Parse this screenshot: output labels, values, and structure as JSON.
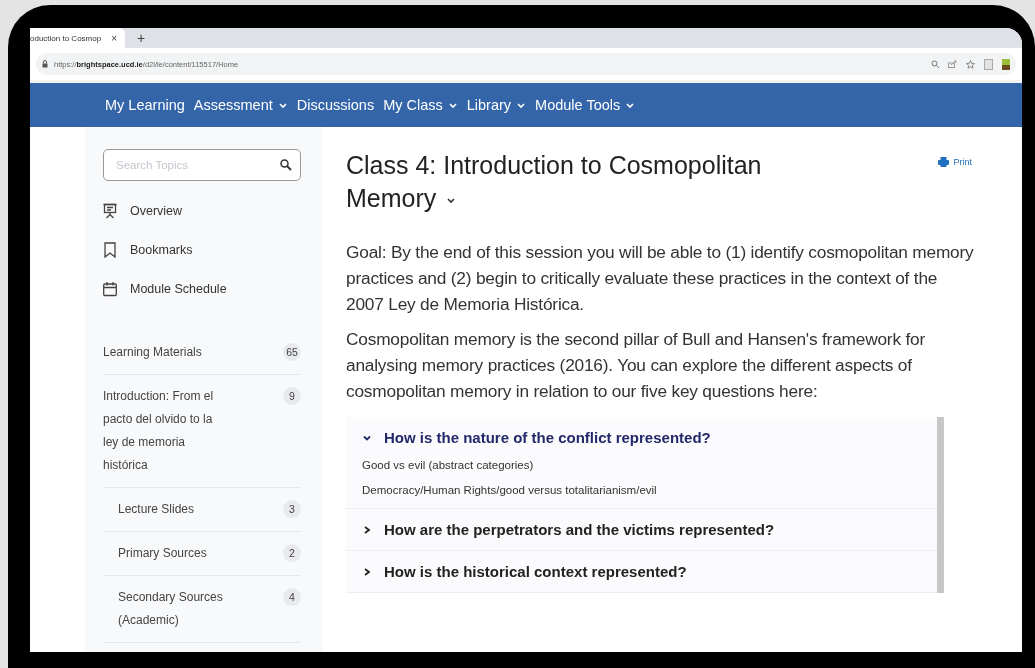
{
  "browser": {
    "tab_title": "oduction to Cosmop",
    "tab_close": "×",
    "new_tab": "+",
    "url": "https://**brightspace.ucd.ie**/d2l/le/content/115517/Home"
  },
  "nav": [
    {
      "label": "My Learning",
      "has_menu": false
    },
    {
      "label": "Assessment",
      "has_menu": true
    },
    {
      "label": "Discussions",
      "has_menu": false
    },
    {
      "label": "My Class",
      "has_menu": true
    },
    {
      "label": "Library",
      "has_menu": true
    },
    {
      "label": "Module Tools",
      "has_menu": true
    }
  ],
  "sidebar": {
    "search": {
      "placeholder": "Search Topics"
    },
    "tools": [
      {
        "label": "Overview",
        "kind": "presentation"
      },
      {
        "label": "Bookmarks",
        "kind": "bookmark"
      },
      {
        "label": "Module Schedule",
        "kind": "calendar"
      }
    ],
    "materials": {
      "label": "Learning Materials",
      "count": "65",
      "children": [
        {
          "label": "Introduction: From el pacto del olvido to la ley de memoria histórica",
          "count": "9",
          "children": [
            {
              "label": "Lecture Slides",
              "count": "3"
            },
            {
              "label": "Primary Sources",
              "count": "2"
            },
            {
              "label": "Secondary Sources (Academic)",
              "count": "4"
            }
          ]
        }
      ]
    }
  },
  "content": {
    "title": "Class 4: Introduction to Cosmopolitan Memory",
    "print": "Print",
    "paragraphs": [
      "Goal: By the end of this session you will be able to (1) identify cosmopolitan memory practices  and (2) begin to critically evaluate these practices in the context of the 2007 Ley de Memoria Histórica.",
      "Cosmopolitan memory is the second pillar of Bull and Hansen's framework for analysing memory practices (2016). You can explore the different aspects of cosmopolitan memory in relation to our five key questions here:"
    ],
    "accordion": [
      {
        "question": "How is the nature of the conflict represented?",
        "expanded": true,
        "body": [
          "Good vs evil (abstract categories)",
          "Democracy/Human Rights/good versus totalitarianism/evil"
        ]
      },
      {
        "question": "How are the perpetrators and the victims represented?",
        "expanded": false
      },
      {
        "question": "How is the historical context represented?",
        "expanded": false
      }
    ]
  }
}
